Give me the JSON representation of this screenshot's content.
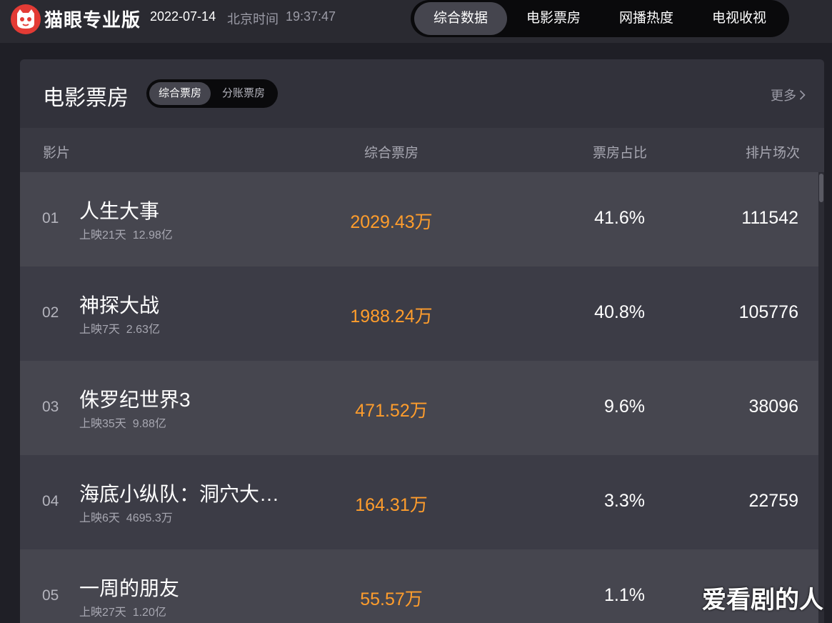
{
  "header": {
    "logo_icon": "cat-logo-icon",
    "brand": "猫眼专业版",
    "date": "2022-07-14",
    "clock_label": "北京时间",
    "clock_time": "19:37:47",
    "nav": [
      "综合数据",
      "电影票房",
      "网播热度",
      "电视收视"
    ],
    "nav_active": 0
  },
  "card": {
    "title": "电影票房",
    "segments": [
      "综合票房",
      "分账票房"
    ],
    "segment_active": 0,
    "more_label": "更多",
    "more_icon": "chevron-right-icon",
    "columns": [
      "影片",
      "综合票房",
      "票房占比",
      "排片场次"
    ]
  },
  "rows": [
    {
      "rank": "01",
      "name": "人生大事",
      "days": "上映21天",
      "total": "12.98亿",
      "gross": "2029.43万",
      "share": "41.6%",
      "shows": "111542"
    },
    {
      "rank": "02",
      "name": "神探大战",
      "days": "上映7天",
      "total": "2.63亿",
      "gross": "1988.24万",
      "share": "40.8%",
      "shows": "105776"
    },
    {
      "rank": "03",
      "name": "侏罗纪世界3",
      "days": "上映35天",
      "total": "9.88亿",
      "gross": "471.52万",
      "share": "9.6%",
      "shows": "38096"
    },
    {
      "rank": "04",
      "name": "海底小纵队：洞穴大…",
      "days": "上映6天",
      "total": "4695.3万",
      "gross": "164.31万",
      "share": "3.3%",
      "shows": "22759"
    },
    {
      "rank": "05",
      "name": "一周的朋友",
      "days": "上映27天",
      "total": "1.20亿",
      "gross": "55.57万",
      "share": "1.1%",
      "shows": ""
    }
  ],
  "watermark": "爱看剧的人",
  "colors": {
    "accent_orange": "#ff9d2c",
    "logo_red": "#e33b35",
    "background": "#1f1f26"
  }
}
